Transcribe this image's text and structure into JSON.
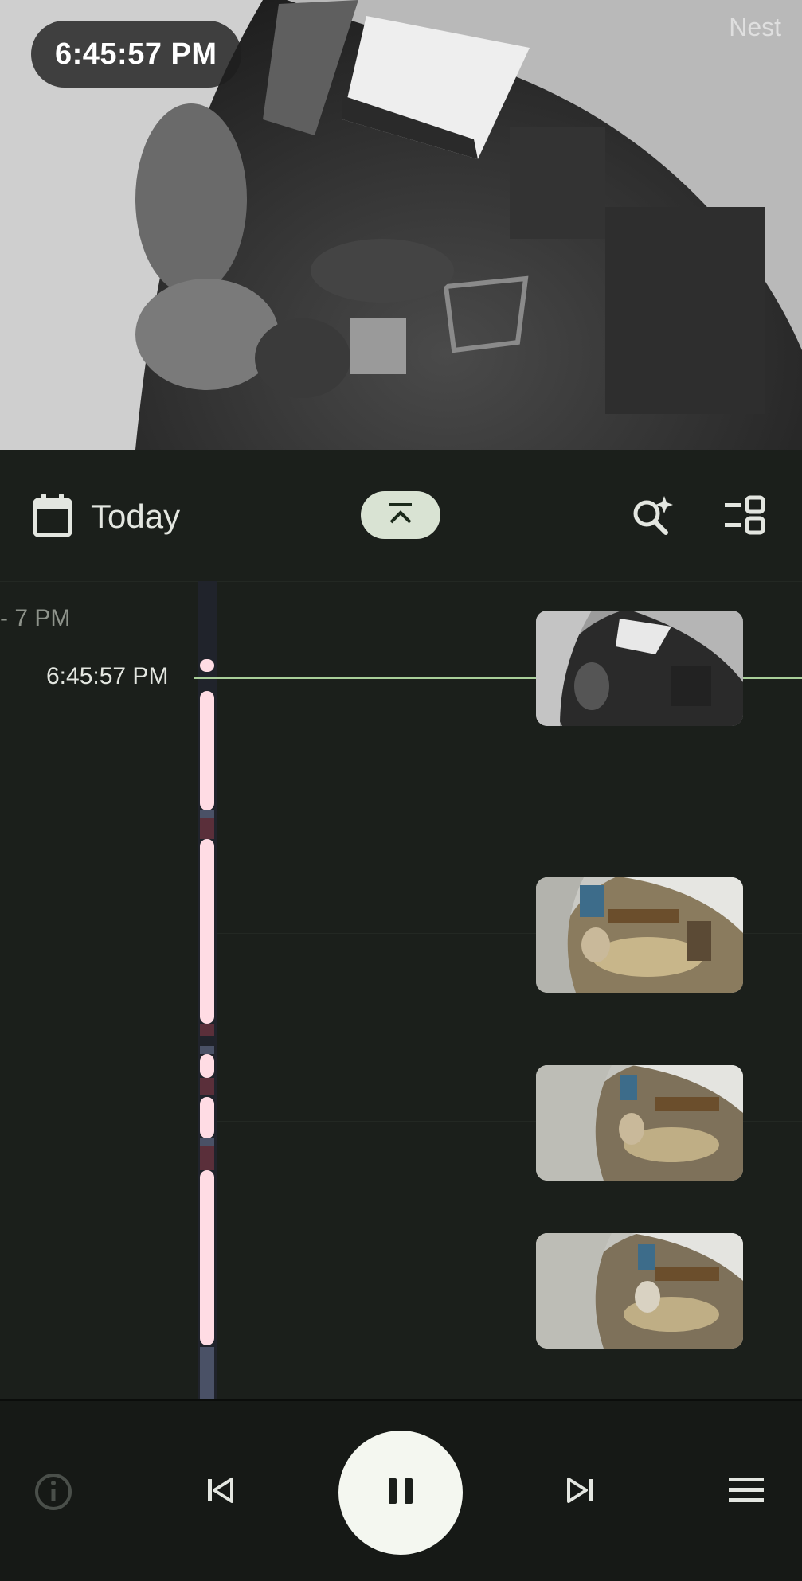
{
  "feed": {
    "timestamp": "6:45:57 PM",
    "watermark": "Nest"
  },
  "toolbar": {
    "date_label": "Today",
    "icons": {
      "calendar": "calendar-icon",
      "collapse": "chevron-up-collapse-icon",
      "search": "sparkle-search-icon",
      "view": "view-toggle-icon"
    }
  },
  "timeline": {
    "hour_label": "- 7 PM",
    "current_time_label": "6:45:57 PM",
    "thumbnails": [
      {
        "name": "event-thumbnail-1",
        "scene": "night-mono"
      },
      {
        "name": "event-thumbnail-2",
        "scene": "day-color"
      },
      {
        "name": "event-thumbnail-3",
        "scene": "day-color"
      },
      {
        "name": "event-thumbnail-4",
        "scene": "day-color"
      }
    ],
    "colors": {
      "event": "#ffdce4",
      "activity": "#5a2f3a",
      "idle": "#4a5166",
      "now_line": "#a9cf9a"
    }
  },
  "controls": {
    "info": "info-icon",
    "previous": "skip-previous-icon",
    "play_pause": "pause-icon",
    "next": "skip-next-icon",
    "menu": "menu-icon"
  },
  "colors": {
    "background": "#1b1f1b",
    "accent_chip": "#d9e3d3",
    "play_button": "#f4f7f0"
  }
}
